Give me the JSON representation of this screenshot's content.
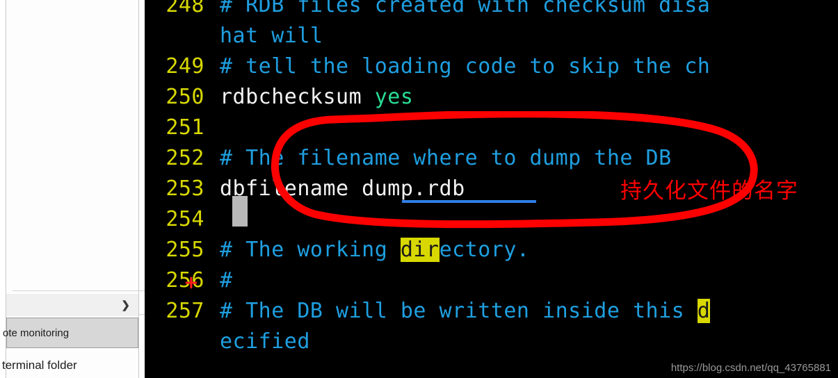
{
  "watermark": "https://blog.csdn.net/qq_43765881",
  "sidebar": {
    "submenu_arrow_icon": "chevron-right-icon",
    "items": [
      {
        "label": " ",
        "state": "normal"
      },
      {
        "label": "ote monitoring",
        "state": "highlighted"
      },
      {
        "label": "terminal folder",
        "state": "normal"
      }
    ]
  },
  "annotations": {
    "chinese_note": "持久化文件的名字",
    "plus_marker": "+",
    "ellipse_color": "#ff0000",
    "underline_color": "#2f7fe8",
    "highlight_color": "#d8d800"
  },
  "terminal": {
    "background": "#000000",
    "lineno_color": "#d8d800",
    "comment_color": "#1f9fe0",
    "text_color": "#f2f2f2",
    "value_color": "#28dd94",
    "cursor_color": "#b9b9b9",
    "lines": [
      {
        "no": "248",
        "segments": [
          {
            "text": "# RDB files created with checksum disa",
            "class": "cmt"
          }
        ]
      },
      {
        "no": "",
        "segments": [
          {
            "text": "hat will",
            "class": "cmt"
          }
        ]
      },
      {
        "no": "249",
        "segments": [
          {
            "text": "# tell the loading code to skip the ch",
            "class": "cmt"
          }
        ]
      },
      {
        "no": "250",
        "segments": [
          {
            "text": "rdbchecksum ",
            "class": "plain"
          },
          {
            "text": "yes",
            "class": "val"
          }
        ]
      },
      {
        "no": "251",
        "segments": []
      },
      {
        "no": "252",
        "segments": [
          {
            "text": "# The filename where to dump the DB",
            "class": "cmt"
          }
        ]
      },
      {
        "no": "253",
        "segments": [
          {
            "text": "dbfilename dump.rdb",
            "class": "plain"
          }
        ]
      },
      {
        "no": "254",
        "segments": []
      },
      {
        "no": "255",
        "segments": [
          {
            "text": "# The working ",
            "class": "cmt"
          },
          {
            "text": "dir",
            "class": "hl"
          },
          {
            "text": "ectory.",
            "class": "cmt"
          }
        ]
      },
      {
        "no": "256",
        "segments": [
          {
            "text": "#",
            "class": "cmt"
          }
        ]
      },
      {
        "no": "257",
        "segments": [
          {
            "text": "# The DB will be written inside this ",
            "class": "cmt"
          },
          {
            "text": "d",
            "class": "hl"
          }
        ]
      },
      {
        "no": "",
        "segments": [
          {
            "text": "ecified",
            "class": "cmt"
          }
        ]
      }
    ]
  }
}
